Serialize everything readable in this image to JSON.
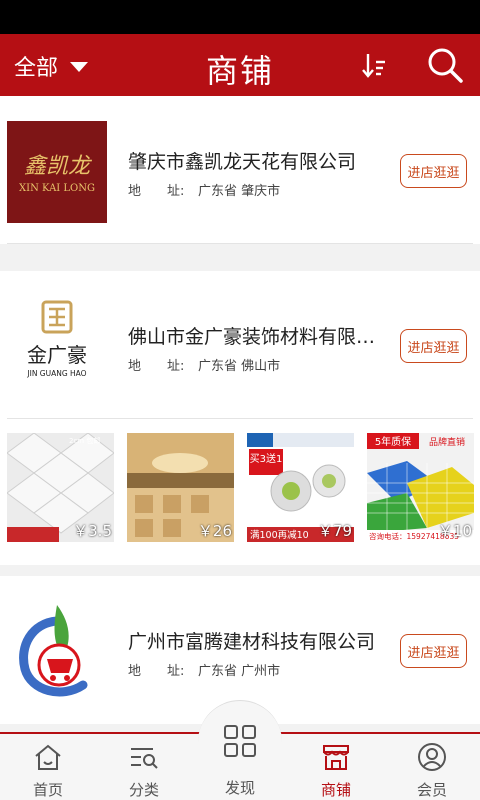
{
  "header": {
    "filter_label": "全部",
    "title": "商铺",
    "sort_icon": "sort-icon",
    "search_icon": "search-icon"
  },
  "shops": [
    {
      "name": "肇庆市鑫凯龙天花有限公司",
      "address_label": "地　　址:",
      "address": "广东省 肇庆市",
      "visit_label": "进店逛逛",
      "logo": {
        "cn": "鑫凯龙",
        "en": "XIN KAI LONG",
        "bg": "#7e1516"
      }
    },
    {
      "name": "佛山市金广豪装饰材料有限公...",
      "address_label": "地　　址:",
      "address": "广东省 佛山市",
      "visit_label": "进店逛逛",
      "logo": {
        "cn": "金广豪",
        "en": "JIN GUANG HAO"
      },
      "products": [
        {
          "price": "￥3.5",
          "label": "2cm 包邮"
        },
        {
          "price": "￥26"
        },
        {
          "price": "￥79",
          "banner": "买3送1",
          "caption": "满100再减10"
        },
        {
          "price": "￥10",
          "banner": "5年质保",
          "tag": "品牌直销",
          "caption": "咨询电话：15927418635"
        }
      ]
    },
    {
      "name": "广州市富腾建材科技有限公司",
      "address_label": "地　　址:",
      "address": "广东省 广州市",
      "visit_label": "进店逛逛"
    }
  ],
  "tabbar": {
    "home": "首页",
    "category": "分类",
    "discover": "发现",
    "shops": "商铺",
    "member": "会员"
  },
  "colors": {
    "brand": "#b50f14",
    "button": "#c94a1e"
  }
}
